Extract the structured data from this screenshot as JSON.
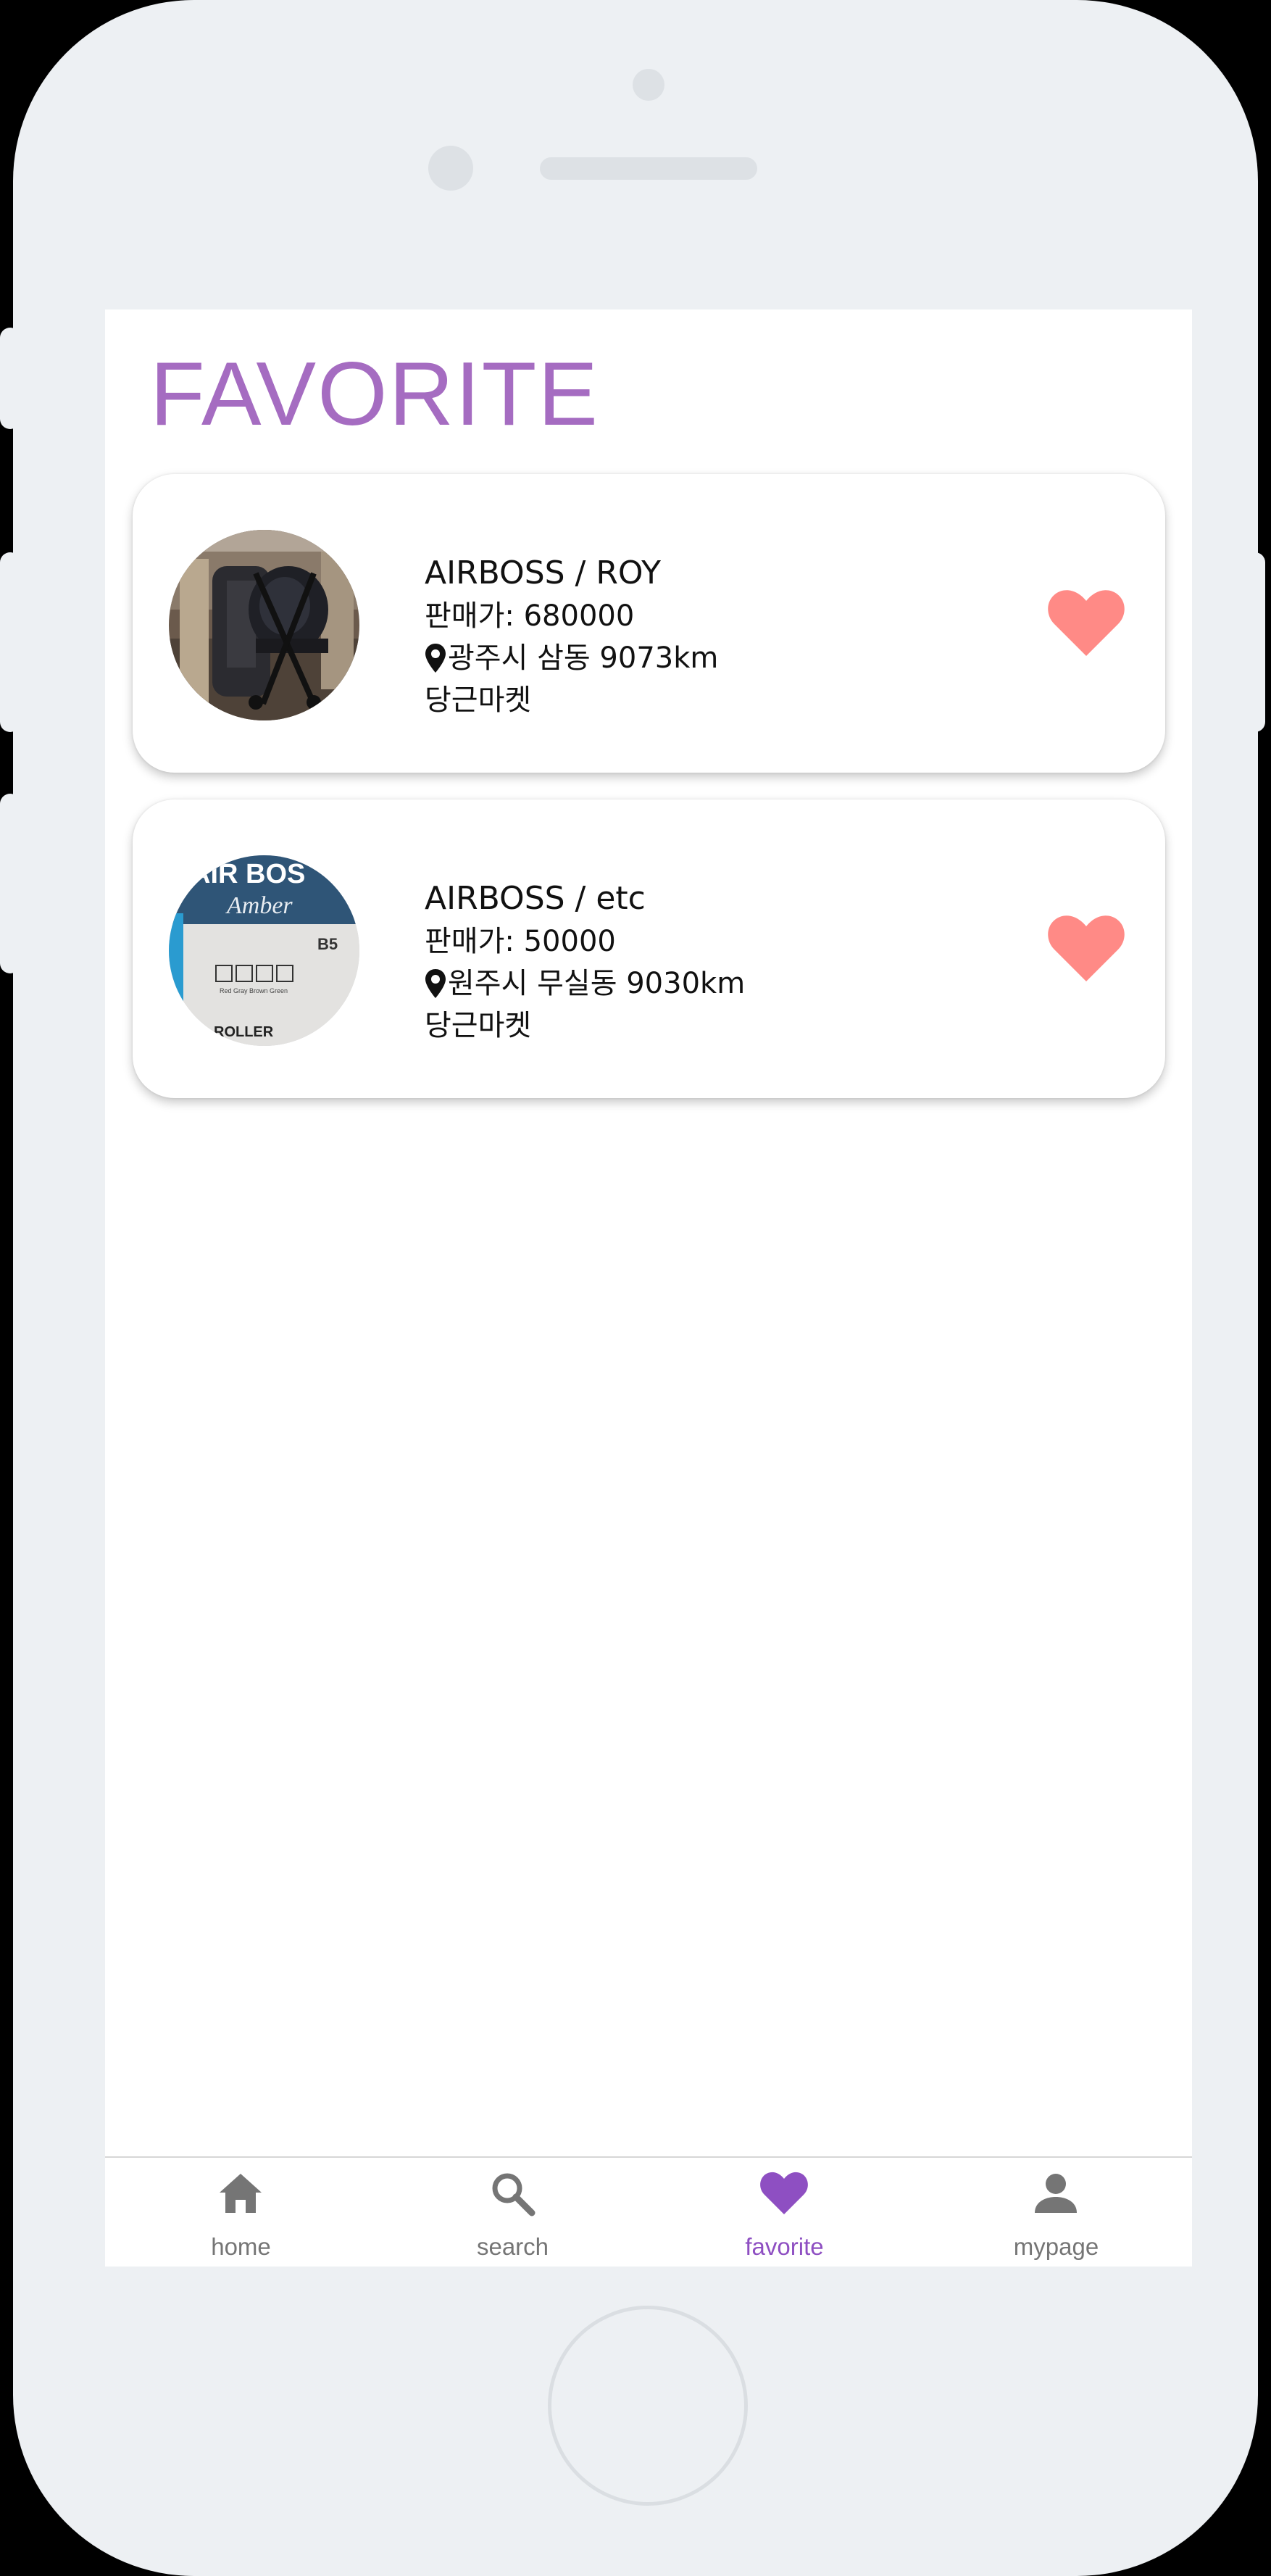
{
  "page_title": "FAVORITE",
  "items": [
    {
      "title": "AIRBOSS / ROY",
      "price": "판매가: 680000",
      "location": "광주시 삼동 9073km",
      "seller": "당근마켓",
      "favorited": true
    },
    {
      "title": "AIRBOSS / etc",
      "price": "판매가: 50000",
      "location": "원주시 무실동 9030km",
      "seller": "당근마켓",
      "favorited": true
    }
  ],
  "tabs": [
    {
      "label": "home",
      "icon": "home-icon",
      "active": false
    },
    {
      "label": "search",
      "icon": "search-icon",
      "active": false
    },
    {
      "label": "favorite",
      "icon": "heart-icon",
      "active": true
    },
    {
      "label": "mypage",
      "icon": "person-icon",
      "active": false
    }
  ],
  "colors": {
    "title": "#a56cc1",
    "favorite_heart": "#ff8a86",
    "active_tab": "#8e4fc2",
    "inactive_tab": "#757575",
    "device_frame": "#edf0f3"
  }
}
